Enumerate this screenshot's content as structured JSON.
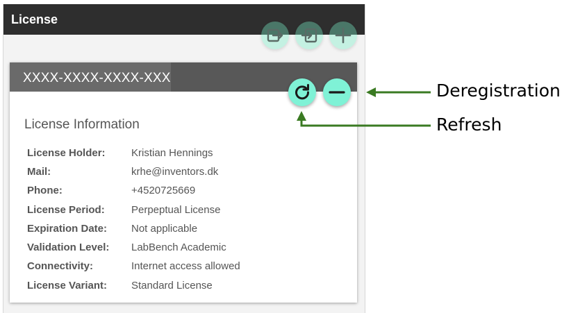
{
  "panel": {
    "title": "License",
    "toolbar": {
      "export_icon": "export-icon",
      "import_icon": "import-icon",
      "add_icon": "plus-icon"
    }
  },
  "card": {
    "license_key": "XXXX-XXXX-XXXX-XXX",
    "refresh_icon": "refresh-icon",
    "deregister_icon": "minus-icon",
    "section_title": "License Information",
    "rows": [
      {
        "label": "License Holder:",
        "value": "Kristian Hennings"
      },
      {
        "label": "Mail:",
        "value": "krhe@inventors.dk"
      },
      {
        "label": "Phone:",
        "value": "+4520725669"
      },
      {
        "label": "License Period:",
        "value": "Perpeptual License"
      },
      {
        "label": "Expiration Date:",
        "value": "Not applicable"
      },
      {
        "label": "Validation Level:",
        "value": "LabBench Academic"
      },
      {
        "label": "Connectivity:",
        "value": "Internet access allowed"
      },
      {
        "label": "License Variant:",
        "value": "Standard License"
      }
    ]
  },
  "annotations": {
    "deregistration": "Deregistration",
    "refresh": "Refresh"
  },
  "colors": {
    "header_dark": "#2e2e2e",
    "card_header": "#585858",
    "fab_accent": "#7ff2d6",
    "arrow_green": "#3a7a22"
  }
}
